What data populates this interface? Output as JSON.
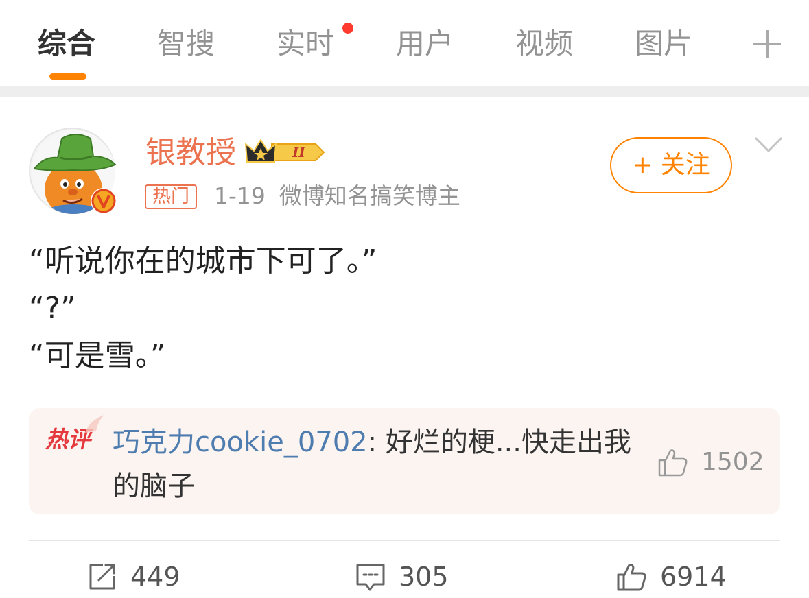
{
  "tabs": [
    {
      "label": "综合",
      "active": true
    },
    {
      "label": "智搜",
      "active": false
    },
    {
      "label": "实时",
      "active": false,
      "has_dot": true
    },
    {
      "label": "用户",
      "active": false
    },
    {
      "label": "视频",
      "active": false
    },
    {
      "label": "图片",
      "active": false
    }
  ],
  "colors": {
    "accent": "#ff8200",
    "username": "#eb7350",
    "link": "#507daf",
    "hot": "#e43a3d"
  },
  "post": {
    "username": "银教授",
    "member_badge": "II",
    "tag": "热门",
    "date": "1-19",
    "description": "微博知名搞笑博主",
    "follow_label": "+ 关注",
    "lines": [
      "“听说你在的城市下可了。”",
      "“?”",
      "“可是雪。”"
    ],
    "hot_comment": {
      "label": "热评",
      "author": "巧克力cookie_0702",
      "text": ": 好烂的梗...快走出我的脑子",
      "likes": "1502"
    },
    "reposts": "449",
    "comments": "305",
    "likes": "6914"
  },
  "icons": {
    "avatar": "avatar-cartoon-hat",
    "verified": "verified-v-icon",
    "crown": "crown-icon",
    "more": "chevron-down-icon",
    "repost": "repost-icon",
    "comment": "comment-icon",
    "like": "thumbs-up-icon",
    "add_tab": "plus-icon"
  }
}
